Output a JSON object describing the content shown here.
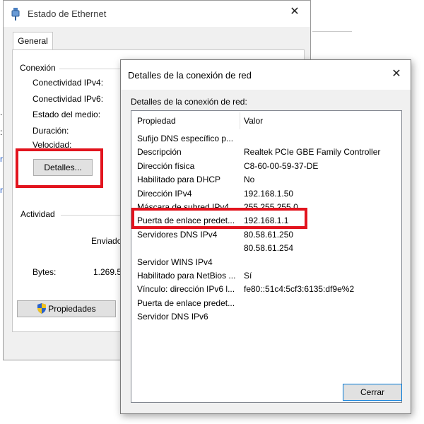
{
  "back_window": {
    "title": "Estado de Ethernet",
    "close_glyph": "✕",
    "tab_general": "General",
    "connection_group": "Conexión",
    "connection_props": [
      "Conectividad IPv4:",
      "Conectividad IPv6:",
      "Estado del medio:",
      "Duración:",
      "Velocidad:"
    ],
    "details_button": "Detalles...",
    "activity_group": "Actividad",
    "sent_label": "Enviado",
    "bytes_label": "Bytes:",
    "bytes_sent": "1.269.5",
    "properties_button": "Propiedades",
    "icon": "ethernet-adapter-icon"
  },
  "front_window": {
    "title": "Detalles de la conexión de red",
    "close_glyph": "✕",
    "list_caption": "Detalles de la conexión de red:",
    "col_property": "Propiedad",
    "col_value": "Valor",
    "rows": [
      {
        "prop": "Sufijo DNS específico p...",
        "value": ""
      },
      {
        "prop": "Descripción",
        "value": "Realtek PCIe GBE Family Controller"
      },
      {
        "prop": "Dirección física",
        "value": "C8-60-00-59-37-DE"
      },
      {
        "prop": "Habilitado para DHCP",
        "value": "No"
      },
      {
        "prop": "Dirección IPv4",
        "value": "192.168.1.50"
      },
      {
        "prop": "Máscara de subred IPv4",
        "value": "255.255.255.0"
      },
      {
        "prop": "Puerta de enlace predet...",
        "value": "192.168.1.1"
      },
      {
        "prop": "Servidores DNS IPv4",
        "value": "80.58.61.250"
      },
      {
        "prop": "",
        "value": "80.58.61.254"
      },
      {
        "prop": "Servidor WINS IPv4",
        "value": ""
      },
      {
        "prop": "Habilitado para NetBios ...",
        "value": "Sí"
      },
      {
        "prop": "Vínculo: dirección IPv6 l...",
        "value": "fe80::51c4:5cf3:6135:df9e%2"
      },
      {
        "prop": "Puerta de enlace predet...",
        "value": ""
      },
      {
        "prop": "Servidor DNS IPv6",
        "value": ""
      }
    ],
    "close_button": "Cerrar"
  },
  "colors": {
    "highlight_box": "#e2141e",
    "link_blue": "#1a55c4",
    "default_button_border": "#0078d7"
  }
}
